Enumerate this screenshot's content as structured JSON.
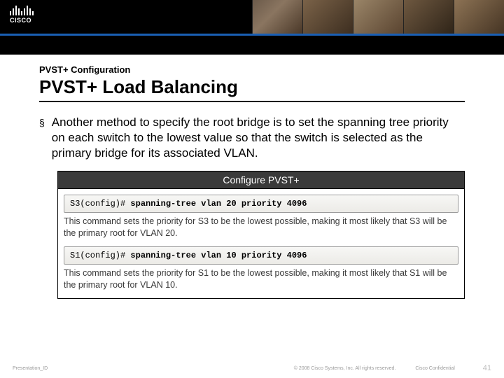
{
  "logo_text": "CISCO",
  "kicker": "PVST+ Configuration",
  "title": "PVST+ Load Balancing",
  "bullet": "Another method to specify the root bridge is to set the spanning tree priority on each switch to the lowest value so that the switch is selected as the primary bridge for its associated VLAN.",
  "panel": {
    "heading": "Configure PVST+",
    "row1_prompt": "S3(config)#",
    "row1_cmd": "spanning-tree vlan 20 priority 4096",
    "row1_note": "This command sets the priority for S3 to be the lowest possible, making it most likely that S3 will be the primary root for VLAN 20.",
    "row2_prompt": "S1(config)#",
    "row2_cmd": "spanning-tree vlan 10 priority 4096",
    "row2_note": "This command sets the priority for S1 to be the lowest possible, making it most likely that S1 will be the primary root for VLAN 10."
  },
  "footer": {
    "id": "Presentation_ID",
    "copyright": "© 2008 Cisco Systems, Inc. All rights reserved.",
    "confidential": "Cisco Confidential",
    "page": "41"
  }
}
